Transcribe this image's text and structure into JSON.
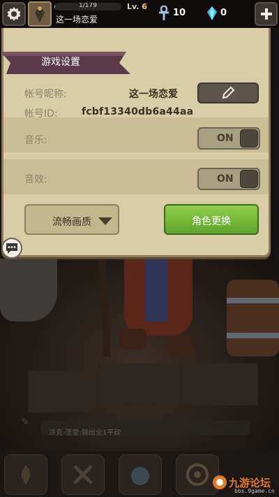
{
  "hud": {
    "exp_text": "1/179",
    "exp_fraction": 0.0056,
    "player_name": "这一场恋爱",
    "level_prefix": "Lv.",
    "level_value": "6",
    "ankh_count": "10",
    "gem_count": "0",
    "icons": {
      "settings": "gear-icon",
      "avatar": "avatar",
      "ankh": "ankh-icon",
      "gem": "gem-icon",
      "add": "plus-icon"
    }
  },
  "settings": {
    "title": "游戏设置",
    "account_nickname_label": "帐号昵称:",
    "account_nickname_value": "这一场恋爱",
    "account_id_label": "帐号ID:",
    "account_id_value": "fcbf13340db6a44aa",
    "music_label": "音乐:",
    "music_toggle": "ON",
    "sfx_label": "音效:",
    "sfx_toggle": "ON",
    "quality_value": "流畅画质",
    "change_character_label": "角色更换"
  },
  "chat": {
    "message": "凉克-圣堂:输出全1平砍"
  },
  "watermark": {
    "title": "九游论坛",
    "url": "bbs.9game.cn"
  },
  "colors": {
    "panel": "#d8cda7",
    "banner": "#5a3a48",
    "accent_green": "#6fb934",
    "level_gold": "#ffd24b",
    "gem_cyan": "#3fc7d9"
  }
}
